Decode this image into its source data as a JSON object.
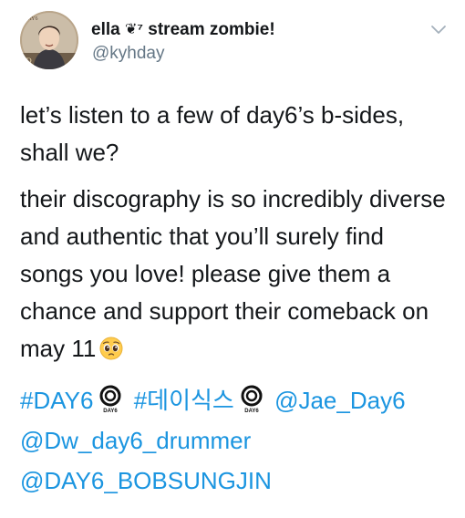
{
  "author": {
    "display_name": "ella",
    "name_emoji": "❦⁷",
    "name_suffix": "stream zombie!",
    "handle": "@kyhday",
    "avatar_text": "DAY6"
  },
  "tweet": {
    "paragraph_1": "let’s listen to a few of day6’s b-sides, shall we?",
    "paragraph_2": "their discography is so incredibly diverse and authentic that you’ll surely find songs you love! please give them a chance and support their comeback on may 11",
    "emoji": "pleading-face",
    "hashtag_1": "#DAY6",
    "hashtag_2": "#데이식스",
    "mention_1": "@Jae_Day6",
    "mention_2": "@Dw_day6_drummer",
    "mention_3": "@DAY6_BOBSUNGJIN",
    "logo_text": "DAY6"
  },
  "colors": {
    "link": "#1b95e0",
    "text": "#14171a",
    "secondary": "#657786"
  },
  "icons": {
    "menu": "chevron-down-icon",
    "hashtag_emoji": "day6-logo-icon",
    "text_emoji": "pleading-face-icon"
  }
}
